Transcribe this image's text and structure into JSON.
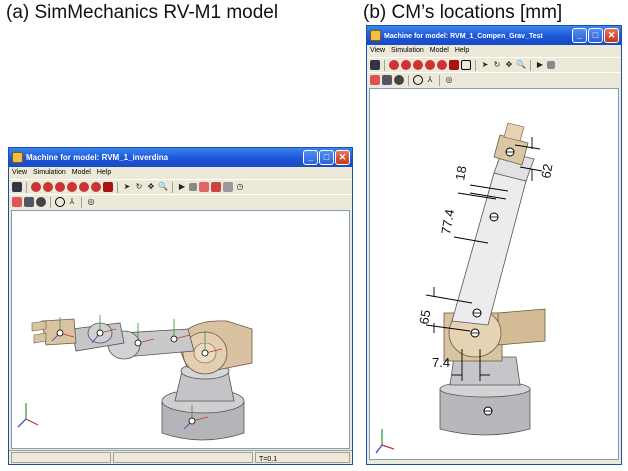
{
  "captions": {
    "a": "(a) SimMechanics RV-M1 model",
    "b": "(b) CM’s locations [mm]"
  },
  "window_a": {
    "title": "Machine for model: RVM_1_inverdina",
    "menu": [
      "View",
      "Simulation",
      "Model",
      "Help"
    ],
    "status_time": "T=0.1"
  },
  "window_b": {
    "title": "Machine for model: RVM_1_Compen_Grav_Test",
    "menu": [
      "View",
      "Simulation",
      "Model",
      "Help"
    ]
  },
  "dimensions": {
    "d1": "18",
    "d2": "62",
    "d3": "77.4",
    "d4": "65",
    "d5": "7.4"
  },
  "colors": {
    "titlebar": "#1c55d8",
    "robot_arm": "#c9c9cc",
    "robot_joint": "#d9c3a0",
    "robot_base": "#b8b8bc"
  }
}
